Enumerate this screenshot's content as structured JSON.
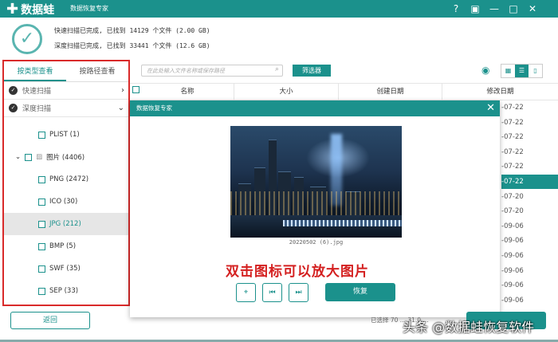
{
  "header": {
    "logo": "数据蛙",
    "subtitle": "数据恢复专家",
    "window_buttons": [
      "help-icon",
      "save-icon",
      "minimize-icon",
      "maximize-icon",
      "close-icon"
    ]
  },
  "summary": {
    "quick": "快速扫描已完成, 已找到 14129 个文件 (2.00 GB)",
    "deep": "深度扫描已完成, 已找到 33441 个文件 (12.6 GB)"
  },
  "left": {
    "tabs": [
      "按类型查看",
      "按路径查看"
    ],
    "quick_scan": "快速扫描",
    "deep_scan": "深度扫描",
    "items": [
      {
        "label": "PLIST (1)"
      },
      {
        "label": "图片 (4406)"
      },
      {
        "label": "PNG (2472)"
      },
      {
        "label": "ICO (30)"
      },
      {
        "label": "JPG (212)"
      },
      {
        "label": "BMP (5)"
      },
      {
        "label": "SWF (35)"
      },
      {
        "label": "SEP (33)"
      }
    ]
  },
  "toolbar": {
    "search_placeholder": "在此处输入文件名称或保存路径",
    "filter": "筛选器"
  },
  "table": {
    "headers": [
      "名称",
      "大小",
      "创建日期",
      "修改日期"
    ],
    "dates": [
      "-07-22",
      "-07-22",
      "-07-22",
      "-07-22",
      "-07-22",
      "-07-22",
      "-07-20",
      "-07-20",
      "-09-06",
      "-09-06",
      "-09-06",
      "-09-06",
      "-09-06",
      "-09-06"
    ],
    "selected_index": 5
  },
  "dialog": {
    "title": "数据恢复专家",
    "filename": "20220502 (6).jpg",
    "hint": "双击图标可以放大图片",
    "recover": "恢复"
  },
  "footer": {
    "back": "返回",
    "status": "已选择 70 ... 31.0 ...",
    "watermark": "头条 @数据蛙恢复软件"
  }
}
